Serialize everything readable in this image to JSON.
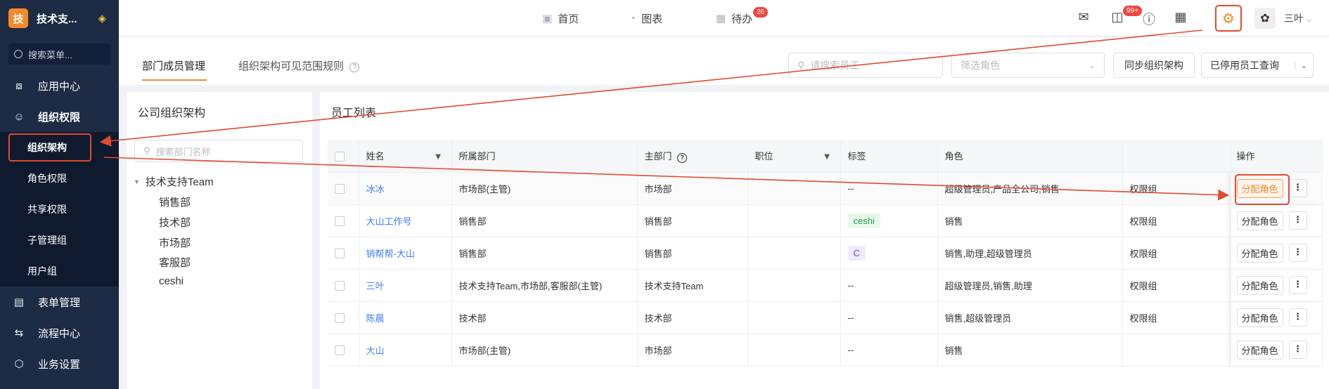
{
  "brand": {
    "logo_char": "技",
    "name": "技术支..."
  },
  "sidebar": {
    "search_placeholder": "搜索菜单...",
    "items": [
      {
        "label": "应用中心",
        "icon": "grid-icon"
      },
      {
        "label": "组织权限",
        "icon": "person-icon"
      }
    ],
    "sub_items": [
      {
        "label": "组织架构"
      },
      {
        "label": "角色权限"
      },
      {
        "label": "共享权限"
      },
      {
        "label": "子管理组"
      },
      {
        "label": "用户组"
      }
    ],
    "bottom_items": [
      {
        "label": "表单管理",
        "icon": "form-icon"
      },
      {
        "label": "流程中心",
        "icon": "flow-icon"
      },
      {
        "label": "业务设置",
        "icon": "cube-icon"
      }
    ]
  },
  "topbar": {
    "nav": [
      {
        "label": "首页"
      },
      {
        "label": "图表"
      },
      {
        "label": "待办",
        "badge": "26"
      }
    ],
    "message_badge": "99+",
    "user_name": "三叶"
  },
  "tabs": {
    "active": "部门成员管理",
    "inactive": "组织架构可见范围规则",
    "employee_search_placeholder": "请搜索员工",
    "role_filter_placeholder": "筛选角色",
    "sync_button": "同步组织架构",
    "disabled_query": "已停用员工查询"
  },
  "org_panel": {
    "title": "公司组织架构",
    "search_placeholder": "搜索部门名称",
    "root": "技术支持Team",
    "children": [
      "销售部",
      "技术部",
      "市场部",
      "客服部",
      "ceshi"
    ]
  },
  "employee_panel": {
    "title": "员工列表",
    "columns": [
      "姓名",
      "所属部门",
      "主部门",
      "职位",
      "标签",
      "角色",
      "",
      "操作"
    ],
    "rows": [
      {
        "name": "冰冰",
        "dept": "市场部(主管)",
        "main_dept": "市场部",
        "position": "",
        "tag": "--",
        "role": "超级管理员,产品全公司,销售",
        "group": "权限组",
        "action": "分配角色"
      },
      {
        "name": "大山工作号",
        "dept": "销售部",
        "main_dept": "销售部",
        "position": "",
        "tag": "ceshi",
        "role": "销售",
        "group": "权限组",
        "action": "分配角色"
      },
      {
        "name": "销帮帮-大山",
        "dept": "销售部",
        "main_dept": "销售部",
        "position": "",
        "tag": "C",
        "role": "销售,助理,超级管理员",
        "group": "权限组",
        "action": "分配角色"
      },
      {
        "name": "三叶",
        "dept": "技术支持Team,市场部,客服部(主管)",
        "main_dept": "技术支持Team",
        "position": "",
        "tag": "--",
        "role": "超级管理员,销售,助理",
        "group": "权限组",
        "action": "分配角色"
      },
      {
        "name": "陈晨",
        "dept": "技术部",
        "main_dept": "技术部",
        "position": "",
        "tag": "--",
        "role": "销售,超级管理员",
        "group": "权限组",
        "action": "分配角色"
      },
      {
        "name": "大山",
        "dept": "市场部(主管)",
        "main_dept": "市场部",
        "position": "",
        "tag": "--",
        "role": "销售",
        "group": "",
        "action": "分配角色"
      }
    ]
  },
  "colors": {
    "accent": "#f58a2a",
    "annotation": "#e24a2f",
    "sidebar_bg": "#1d2b44",
    "link": "#3b7ff5"
  }
}
